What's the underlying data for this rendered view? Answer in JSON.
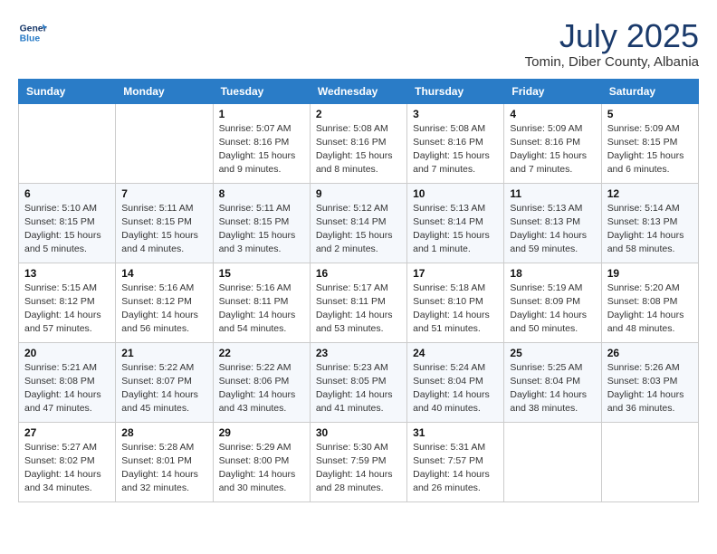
{
  "header": {
    "logo_line1": "General",
    "logo_line2": "Blue",
    "month_year": "July 2025",
    "location": "Tomin, Diber County, Albania"
  },
  "days_of_week": [
    "Sunday",
    "Monday",
    "Tuesday",
    "Wednesday",
    "Thursday",
    "Friday",
    "Saturday"
  ],
  "weeks": [
    [
      null,
      null,
      {
        "day": "1",
        "sunrise": "5:07 AM",
        "sunset": "8:16 PM",
        "daylight": "15 hours and 9 minutes."
      },
      {
        "day": "2",
        "sunrise": "5:08 AM",
        "sunset": "8:16 PM",
        "daylight": "15 hours and 8 minutes."
      },
      {
        "day": "3",
        "sunrise": "5:08 AM",
        "sunset": "8:16 PM",
        "daylight": "15 hours and 7 minutes."
      },
      {
        "day": "4",
        "sunrise": "5:09 AM",
        "sunset": "8:16 PM",
        "daylight": "15 hours and 7 minutes."
      },
      {
        "day": "5",
        "sunrise": "5:09 AM",
        "sunset": "8:15 PM",
        "daylight": "15 hours and 6 minutes."
      }
    ],
    [
      {
        "day": "6",
        "sunrise": "5:10 AM",
        "sunset": "8:15 PM",
        "daylight": "15 hours and 5 minutes."
      },
      {
        "day": "7",
        "sunrise": "5:11 AM",
        "sunset": "8:15 PM",
        "daylight": "15 hours and 4 minutes."
      },
      {
        "day": "8",
        "sunrise": "5:11 AM",
        "sunset": "8:15 PM",
        "daylight": "15 hours and 3 minutes."
      },
      {
        "day": "9",
        "sunrise": "5:12 AM",
        "sunset": "8:14 PM",
        "daylight": "15 hours and 2 minutes."
      },
      {
        "day": "10",
        "sunrise": "5:13 AM",
        "sunset": "8:14 PM",
        "daylight": "15 hours and 1 minute."
      },
      {
        "day": "11",
        "sunrise": "5:13 AM",
        "sunset": "8:13 PM",
        "daylight": "14 hours and 59 minutes."
      },
      {
        "day": "12",
        "sunrise": "5:14 AM",
        "sunset": "8:13 PM",
        "daylight": "14 hours and 58 minutes."
      }
    ],
    [
      {
        "day": "13",
        "sunrise": "5:15 AM",
        "sunset": "8:12 PM",
        "daylight": "14 hours and 57 minutes."
      },
      {
        "day": "14",
        "sunrise": "5:16 AM",
        "sunset": "8:12 PM",
        "daylight": "14 hours and 56 minutes."
      },
      {
        "day": "15",
        "sunrise": "5:16 AM",
        "sunset": "8:11 PM",
        "daylight": "14 hours and 54 minutes."
      },
      {
        "day": "16",
        "sunrise": "5:17 AM",
        "sunset": "8:11 PM",
        "daylight": "14 hours and 53 minutes."
      },
      {
        "day": "17",
        "sunrise": "5:18 AM",
        "sunset": "8:10 PM",
        "daylight": "14 hours and 51 minutes."
      },
      {
        "day": "18",
        "sunrise": "5:19 AM",
        "sunset": "8:09 PM",
        "daylight": "14 hours and 50 minutes."
      },
      {
        "day": "19",
        "sunrise": "5:20 AM",
        "sunset": "8:08 PM",
        "daylight": "14 hours and 48 minutes."
      }
    ],
    [
      {
        "day": "20",
        "sunrise": "5:21 AM",
        "sunset": "8:08 PM",
        "daylight": "14 hours and 47 minutes."
      },
      {
        "day": "21",
        "sunrise": "5:22 AM",
        "sunset": "8:07 PM",
        "daylight": "14 hours and 45 minutes."
      },
      {
        "day": "22",
        "sunrise": "5:22 AM",
        "sunset": "8:06 PM",
        "daylight": "14 hours and 43 minutes."
      },
      {
        "day": "23",
        "sunrise": "5:23 AM",
        "sunset": "8:05 PM",
        "daylight": "14 hours and 41 minutes."
      },
      {
        "day": "24",
        "sunrise": "5:24 AM",
        "sunset": "8:04 PM",
        "daylight": "14 hours and 40 minutes."
      },
      {
        "day": "25",
        "sunrise": "5:25 AM",
        "sunset": "8:04 PM",
        "daylight": "14 hours and 38 minutes."
      },
      {
        "day": "26",
        "sunrise": "5:26 AM",
        "sunset": "8:03 PM",
        "daylight": "14 hours and 36 minutes."
      }
    ],
    [
      {
        "day": "27",
        "sunrise": "5:27 AM",
        "sunset": "8:02 PM",
        "daylight": "14 hours and 34 minutes."
      },
      {
        "day": "28",
        "sunrise": "5:28 AM",
        "sunset": "8:01 PM",
        "daylight": "14 hours and 32 minutes."
      },
      {
        "day": "29",
        "sunrise": "5:29 AM",
        "sunset": "8:00 PM",
        "daylight": "14 hours and 30 minutes."
      },
      {
        "day": "30",
        "sunrise": "5:30 AM",
        "sunset": "7:59 PM",
        "daylight": "14 hours and 28 minutes."
      },
      {
        "day": "31",
        "sunrise": "5:31 AM",
        "sunset": "7:57 PM",
        "daylight": "14 hours and 26 minutes."
      },
      null,
      null
    ]
  ],
  "daylight_label": "Daylight:",
  "sunrise_label": "Sunrise:",
  "sunset_label": "Sunset:"
}
